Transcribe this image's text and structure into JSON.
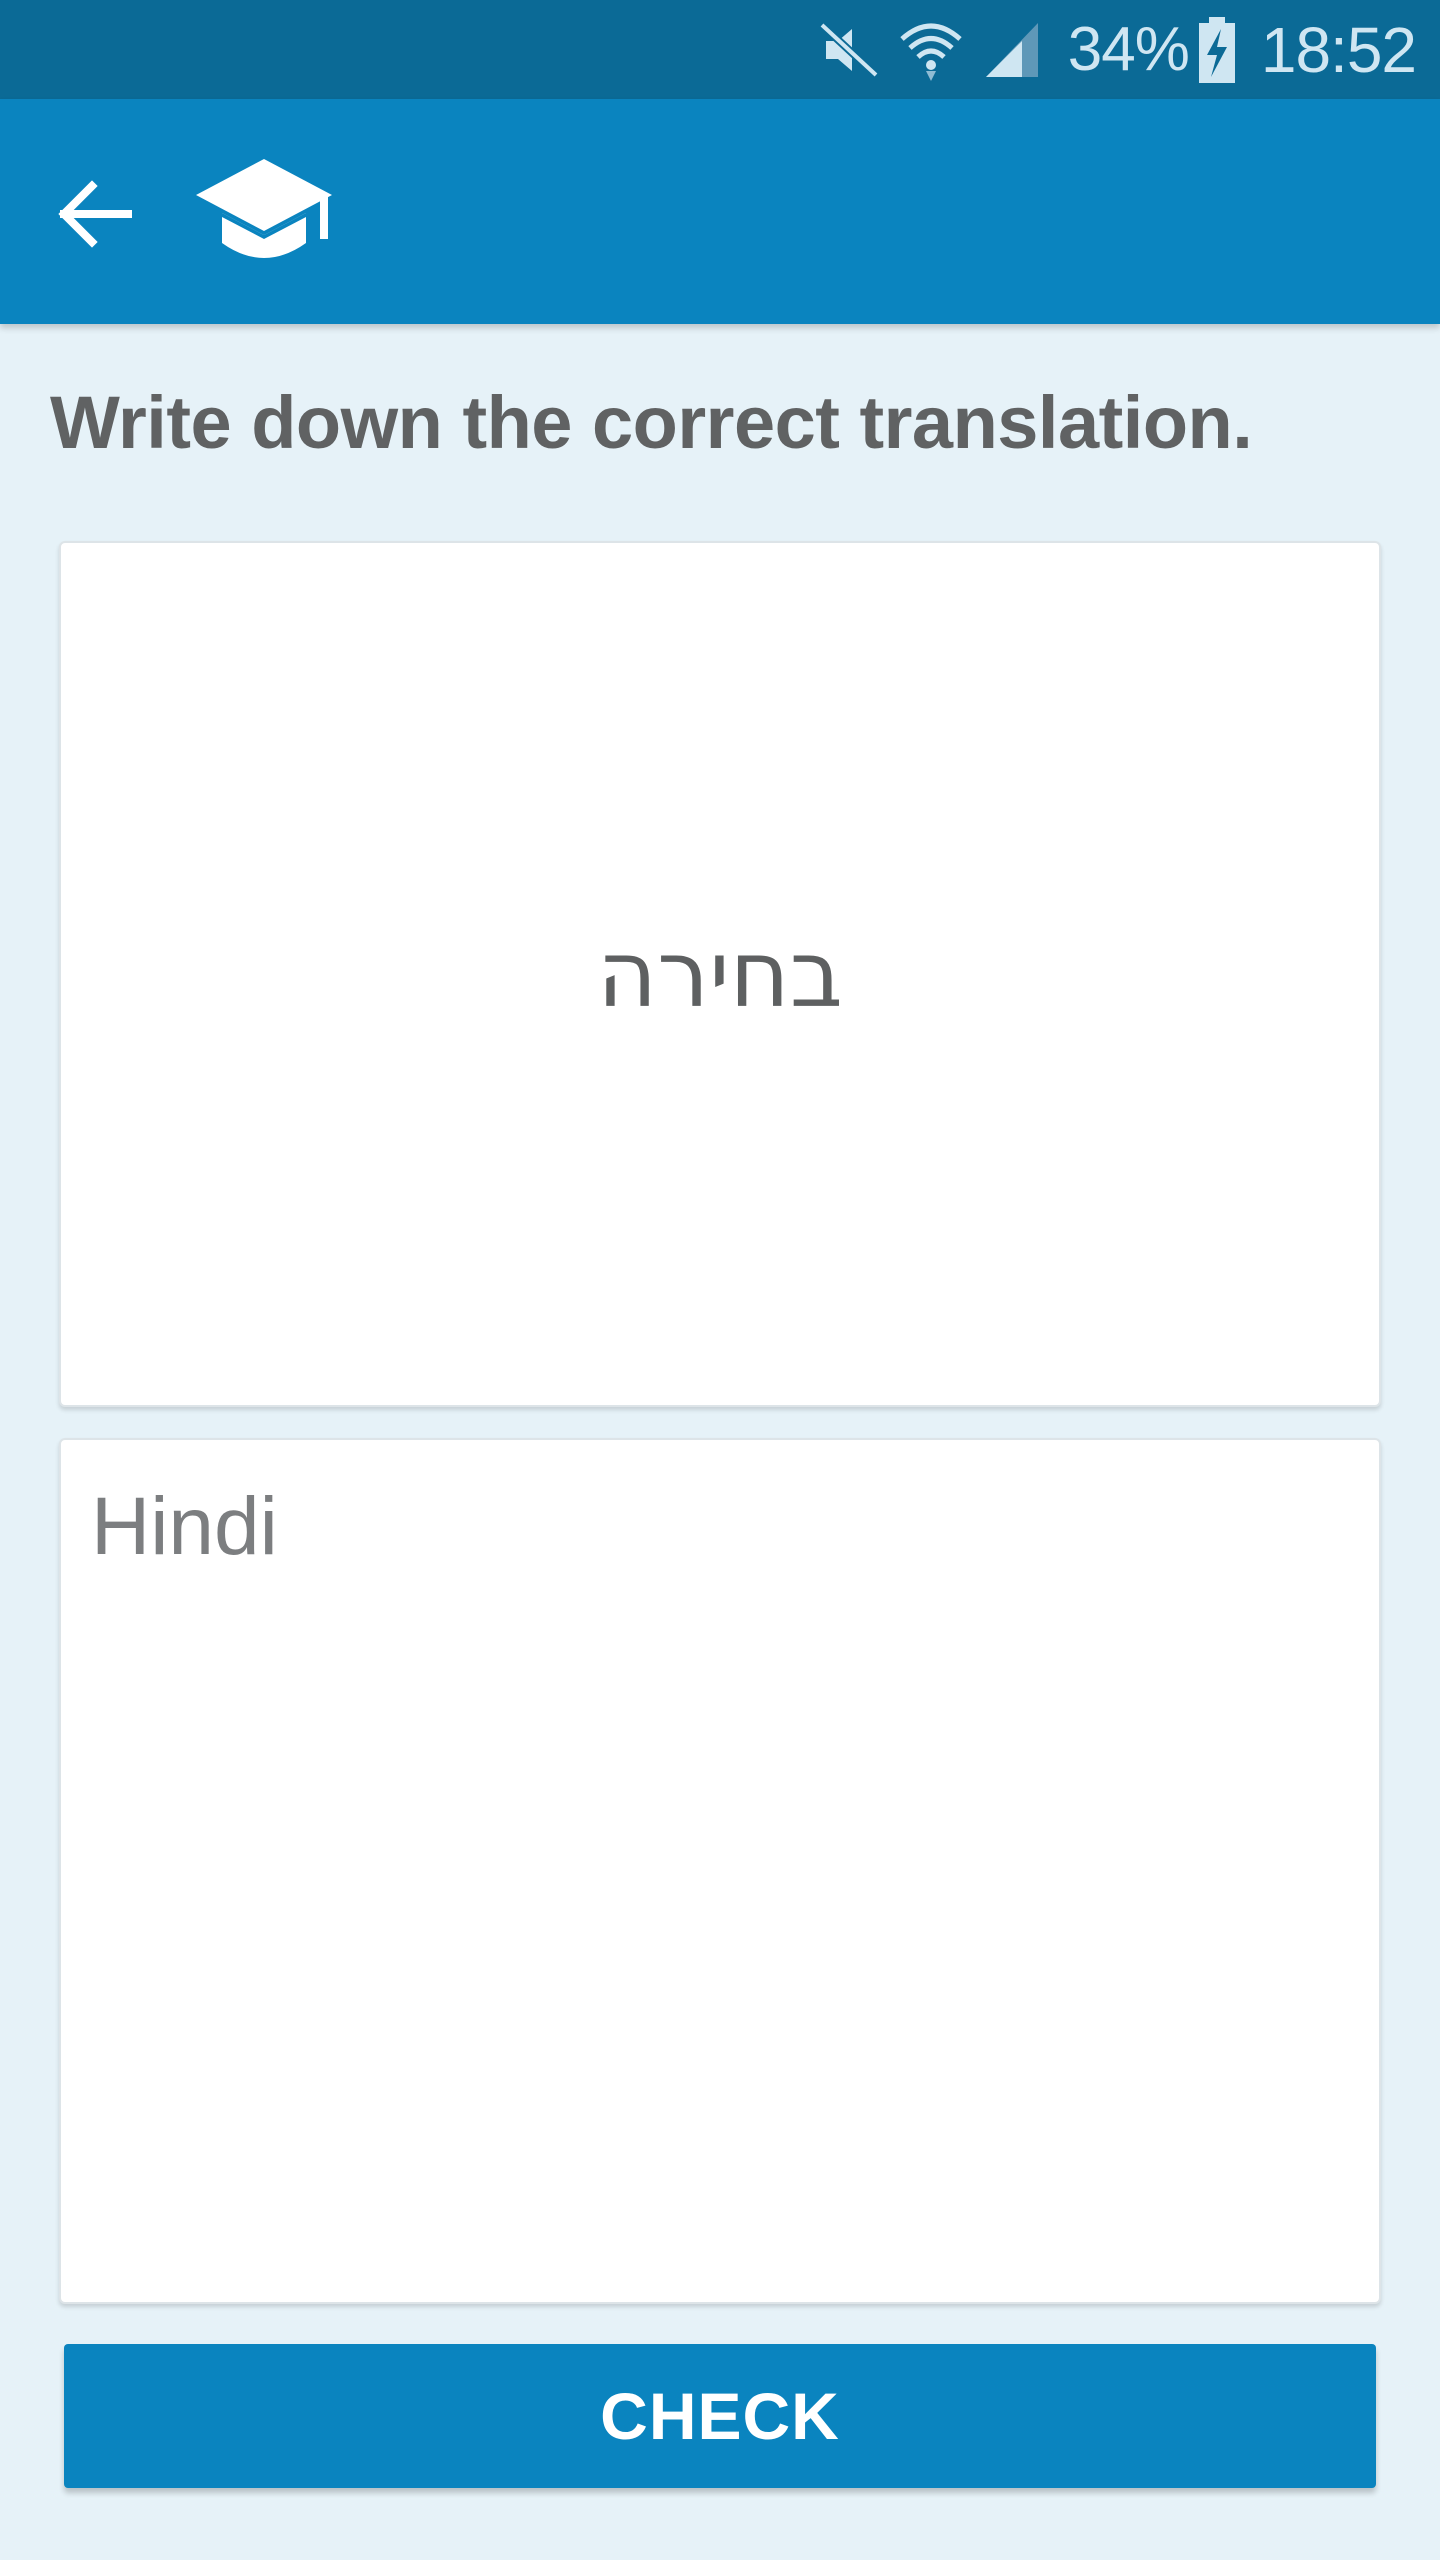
{
  "status_bar": {
    "icons": [
      "mute-icon",
      "wifi-icon",
      "signal-icon",
      "battery-charging-icon"
    ],
    "battery_percent": "34%",
    "time": "18:52",
    "background_color": "#0b6a96"
  },
  "app_bar": {
    "back_icon": "arrow-left-icon",
    "logo_icon": "graduation-cap-icon",
    "background_color": "#0a84bf"
  },
  "exercise": {
    "instruction": "Write down the correct translation.",
    "word": "בחירה",
    "answer_placeholder": "Hindi",
    "answer_value": ""
  },
  "actions": {
    "check_label": "CHECK",
    "accent_color": "#0a84bf"
  }
}
